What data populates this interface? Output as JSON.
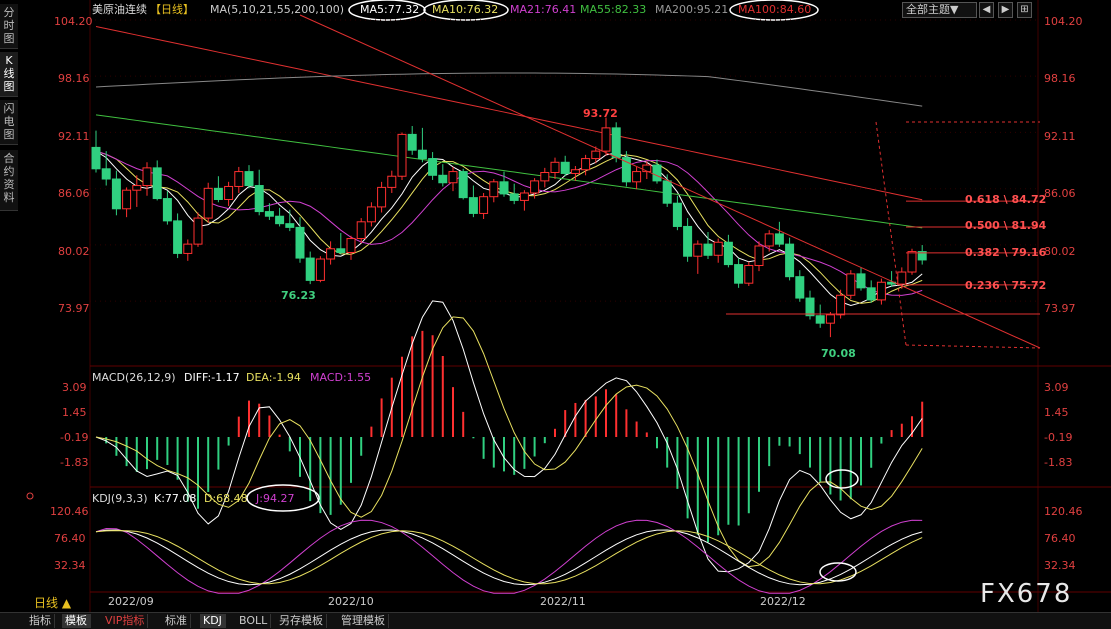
{
  "sidebar": {
    "tabs": [
      {
        "label": "分时图",
        "active": false
      },
      {
        "label": "K线图",
        "active": true
      },
      {
        "label": "闪电图",
        "active": false
      },
      {
        "label": "合约资料",
        "active": false
      }
    ]
  },
  "header": {
    "symbol": "美原油连续",
    "period": "【日线】",
    "ma_params": "MA(5,10,21,55,200,100)",
    "ma_values": [
      {
        "label": "MA5:77.32",
        "color": "#ffffff",
        "circled": true
      },
      {
        "label": "MA10:76.32",
        "color": "#e8e060",
        "circled": true
      },
      {
        "label": "MA21:76.41",
        "color": "#d040d0",
        "circled": false
      },
      {
        "label": "MA55:82.33",
        "color": "#40c040",
        "circled": false
      },
      {
        "label": "MA200:95.21",
        "color": "#888888",
        "circled": false
      },
      {
        "label": "MA100:84.60",
        "color": "#e03030",
        "circled": true
      }
    ],
    "select_label": "全部主题▼",
    "window_buttons": [
      "◀",
      "▶",
      "⊞"
    ]
  },
  "main_axis": {
    "ticks": [
      "104.20",
      "98.16",
      "92.11",
      "86.06",
      "80.02",
      "73.97"
    ]
  },
  "annotations": {
    "high_label": "93.72",
    "low_label_1": "76.23",
    "low_label_2": "70.08",
    "fib_levels": [
      "0.618 \\ 84.72",
      "0.500 \\ 81.94",
      "0.382 \\ 79.16",
      "0.236 \\ 75.72"
    ]
  },
  "macd_panel": {
    "title": "MACD(26,12,9)",
    "diff": "DIFF:-1.17",
    "dea": "DEA:-1.94",
    "macd": "MACD:1.55",
    "ticks": [
      "3.09",
      "1.45",
      "-0.19",
      "-1.83"
    ]
  },
  "kdj_panel": {
    "title": "KDJ(9,3,3)",
    "k": "K:77.08",
    "d": "D:68.48",
    "j": "J:94.27",
    "ticks": [
      "120.46",
      "76.40",
      "32.34"
    ]
  },
  "x_axis": {
    "labels": [
      "2022/09",
      "2022/10",
      "2022/11",
      "2022/12"
    ]
  },
  "watermark": "FX678",
  "period_label": "日线 ▲",
  "bottom_tabs": [
    {
      "label": "指标",
      "active": false,
      "vip": false
    },
    {
      "label": "模板",
      "active": true,
      "vip": false
    },
    {
      "label": "VIP指标",
      "active": false,
      "vip": true
    },
    {
      "label": "标准",
      "active": false,
      "vip": false
    },
    {
      "label": "KDJ",
      "active": true,
      "vip": false
    },
    {
      "label": "BOLL",
      "active": false,
      "vip": false
    },
    {
      "label": "另存模板",
      "active": false,
      "vip": false
    },
    {
      "label": "管理模板",
      "active": false,
      "vip": false
    }
  ],
  "colors": {
    "up": "#ff3030",
    "down": "#30d080",
    "axis_red": "#e04040",
    "ma5": "#ffffff",
    "ma10": "#e8e060",
    "ma21": "#d040d0",
    "ma55": "#40c040",
    "ma200": "#888888",
    "ma100": "#e03030"
  },
  "chart_data": {
    "type": "candlestick",
    "y_range": [
      70.08,
      104.2
    ],
    "candles": [
      [
        90.5,
        92.3,
        87.8,
        88.2
      ],
      [
        88.2,
        90.1,
        86.4,
        87.1
      ],
      [
        87.1,
        88.0,
        83.2,
        83.9
      ],
      [
        83.9,
        86.2,
        83.0,
        85.9
      ],
      [
        85.9,
        87.5,
        84.1,
        86.4
      ],
      [
        86.4,
        88.9,
        85.3,
        88.3
      ],
      [
        88.3,
        89.1,
        84.8,
        85.0
      ],
      [
        85.0,
        85.8,
        82.2,
        82.6
      ],
      [
        82.6,
        83.4,
        78.6,
        79.1
      ],
      [
        79.1,
        80.6,
        78.3,
        80.1
      ],
      [
        80.1,
        83.5,
        79.8,
        82.9
      ],
      [
        82.9,
        86.7,
        82.4,
        86.1
      ],
      [
        86.1,
        87.4,
        84.6,
        84.9
      ],
      [
        84.9,
        86.8,
        84.2,
        86.3
      ],
      [
        86.3,
        88.4,
        85.6,
        87.9
      ],
      [
        87.9,
        88.6,
        86.1,
        86.4
      ],
      [
        86.4,
        88.1,
        83.2,
        83.6
      ],
      [
        83.6,
        84.5,
        82.7,
        83.1
      ],
      [
        83.1,
        84.0,
        82.0,
        82.3
      ],
      [
        82.3,
        83.8,
        81.5,
        81.9
      ],
      [
        81.9,
        83.0,
        78.1,
        78.6
      ],
      [
        78.6,
        79.3,
        75.8,
        76.2
      ],
      [
        76.2,
        78.8,
        76.0,
        78.5
      ],
      [
        78.5,
        80.4,
        77.9,
        79.6
      ],
      [
        79.6,
        81.3,
        79.0,
        79.2
      ],
      [
        79.2,
        81.0,
        78.4,
        80.7
      ],
      [
        80.7,
        82.9,
        80.2,
        82.5
      ],
      [
        82.5,
        84.6,
        82.0,
        84.1
      ],
      [
        84.1,
        86.8,
        83.5,
        86.2
      ],
      [
        86.2,
        88.0,
        85.6,
        87.4
      ],
      [
        87.4,
        92.1,
        87.0,
        91.9
      ],
      [
        91.9,
        92.8,
        89.7,
        90.2
      ],
      [
        90.2,
        92.6,
        88.9,
        89.3
      ],
      [
        89.3,
        90.0,
        87.0,
        87.5
      ],
      [
        87.5,
        88.7,
        86.3,
        86.7
      ],
      [
        86.7,
        88.4,
        85.8,
        87.9
      ],
      [
        87.9,
        88.2,
        84.9,
        85.1
      ],
      [
        85.1,
        86.4,
        83.0,
        83.4
      ],
      [
        83.4,
        85.6,
        82.8,
        85.2
      ],
      [
        85.2,
        87.1,
        84.6,
        86.8
      ],
      [
        86.8,
        87.9,
        85.2,
        85.5
      ],
      [
        85.5,
        86.6,
        84.4,
        84.8
      ],
      [
        84.8,
        85.9,
        83.7,
        85.6
      ],
      [
        85.6,
        87.2,
        85.0,
        86.9
      ],
      [
        86.9,
        88.3,
        86.2,
        87.8
      ],
      [
        87.8,
        89.4,
        87.1,
        88.9
      ],
      [
        88.9,
        89.6,
        87.4,
        87.7
      ],
      [
        87.7,
        88.5,
        86.9,
        88.1
      ],
      [
        88.1,
        89.7,
        87.5,
        89.3
      ],
      [
        89.3,
        90.6,
        88.8,
        90.1
      ],
      [
        90.1,
        93.7,
        89.6,
        92.6
      ],
      [
        92.6,
        93.2,
        88.9,
        89.4
      ],
      [
        89.4,
        90.1,
        86.3,
        86.8
      ],
      [
        86.8,
        88.4,
        86.0,
        87.9
      ],
      [
        87.9,
        89.0,
        87.1,
        88.6
      ],
      [
        88.6,
        89.2,
        86.6,
        86.9
      ],
      [
        86.9,
        87.6,
        84.1,
        84.5
      ],
      [
        84.5,
        85.3,
        81.6,
        82.0
      ],
      [
        82.0,
        82.9,
        78.2,
        78.8
      ],
      [
        78.8,
        80.5,
        76.9,
        80.1
      ],
      [
        80.1,
        81.4,
        78.5,
        78.9
      ],
      [
        78.9,
        80.7,
        78.1,
        80.3
      ],
      [
        80.3,
        81.1,
        77.6,
        77.9
      ],
      [
        77.9,
        78.6,
        75.4,
        75.9
      ],
      [
        75.9,
        78.2,
        75.6,
        77.8
      ],
      [
        77.8,
        80.4,
        77.2,
        79.9
      ],
      [
        79.9,
        81.6,
        79.3,
        81.2
      ],
      [
        81.2,
        82.5,
        79.8,
        80.1
      ],
      [
        80.1,
        80.8,
        76.2,
        76.6
      ],
      [
        76.6,
        77.3,
        73.9,
        74.3
      ],
      [
        74.3,
        75.1,
        72.0,
        72.4
      ],
      [
        72.4,
        73.6,
        71.1,
        71.6
      ],
      [
        71.6,
        72.8,
        70.1,
        72.5
      ],
      [
        72.5,
        75.2,
        72.1,
        74.6
      ],
      [
        74.6,
        77.3,
        74.2,
        76.9
      ],
      [
        76.9,
        77.6,
        75.1,
        75.4
      ],
      [
        75.4,
        76.2,
        73.8,
        74.1
      ],
      [
        74.1,
        76.4,
        73.6,
        76.0
      ],
      [
        76.0,
        77.2,
        75.5,
        75.8
      ],
      [
        75.8,
        77.6,
        75.3,
        77.1
      ],
      [
        77.1,
        79.6,
        76.8,
        79.3
      ],
      [
        79.3,
        80.0,
        77.9,
        78.4
      ]
    ],
    "ma_series": {
      "MA5": [
        90.1,
        89.4,
        88.2,
        87.1,
        86.3,
        86.1,
        86.4,
        85.9,
        84.8,
        83.2,
        82.0,
        82.2,
        82.9,
        83.9,
        85.4,
        86.3,
        86.1,
        85.4,
        84.3,
        83.4,
        82.0,
        80.5,
        79.5,
        78.9,
        78.8,
        79.3,
        80.2,
        81.4,
        82.8,
        84.0,
        85.5,
        87.3,
        88.5,
        89.3,
        89.2,
        88.4,
        87.8,
        86.9,
        86.1,
        85.8,
        85.6,
        85.2,
        85.2,
        85.5,
        85.9,
        86.5,
        87.5,
        88.0,
        88.4,
        88.9,
        89.7,
        89.9,
        89.5,
        89.2,
        88.9,
        88.2,
        87.1,
        85.7,
        83.6,
        82.0,
        80.7,
        80.1,
        79.7,
        78.6,
        78.2,
        78.4,
        79.0,
        79.5,
        79.0,
        78.2,
        77.1,
        75.9,
        74.7,
        73.9,
        73.5,
        73.8,
        74.3,
        75.2,
        75.6,
        75.7,
        76.0,
        76.9
      ]
    },
    "fib_levels": [
      84.72,
      81.94,
      79.16,
      75.72
    ],
    "high": 93.72,
    "lows": [
      76.23,
      70.08
    ]
  }
}
